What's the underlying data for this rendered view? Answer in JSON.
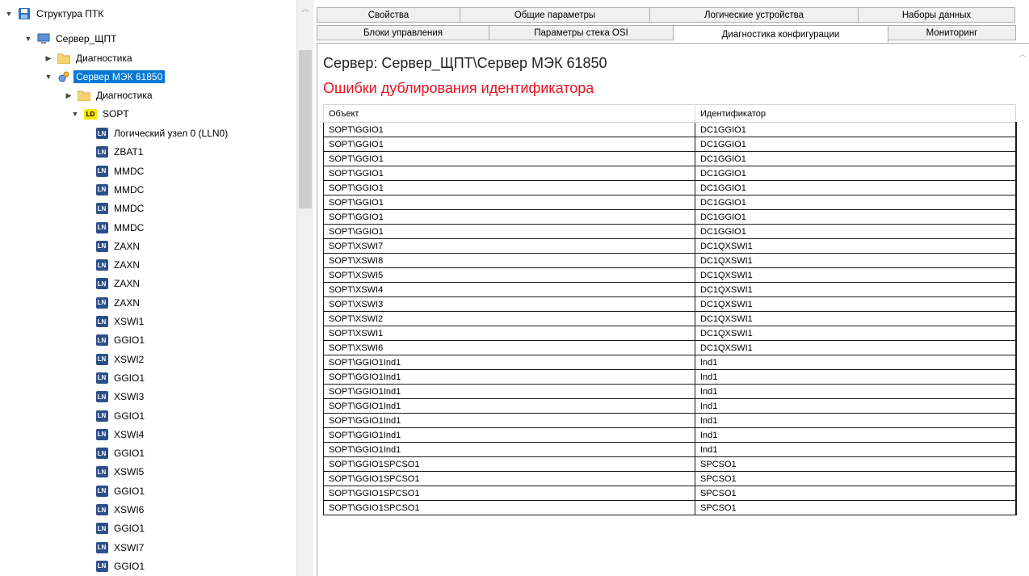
{
  "tree": {
    "root": "Структура ПТК",
    "server": "Сервер_ЩПТ",
    "diag1": "Диагностика",
    "mek_server": "Сервер МЭК 61850",
    "diag2": "Диагностика",
    "ld_badge": "LD",
    "ld_name": "SOPT",
    "ln_badge": "LN",
    "ln_items": [
      "Логический узел 0 (LLN0)",
      "ZBAT1",
      "MMDC",
      "MMDC",
      "MMDC",
      "MMDC",
      "ZAXN",
      "ZAXN",
      "ZAXN",
      "ZAXN",
      "XSWI1",
      "GGIO1",
      "XSWI2",
      "GGIO1",
      "XSWI3",
      "GGIO1",
      "XSWI4",
      "GGIO1",
      "XSWI5",
      "GGIO1",
      "XSWI6",
      "GGIO1",
      "XSWI7",
      "GGIO1"
    ]
  },
  "tabs": {
    "row1": [
      "Свойства",
      "Общие параметры",
      "Логические устройства",
      "Наборы данных"
    ],
    "row2": [
      "Блоки управления",
      "Параметры стека OSI",
      "Диагностика конфигурации",
      "Мониторинг"
    ],
    "active": "Диагностика конфигурации"
  },
  "content": {
    "server_title": "Сервер: Сервер_ЩПТ\\Сервер МЭК 61850",
    "error_title": "Ошибки дублирования идентификатора",
    "columns": [
      "Объект",
      "Идентификатор"
    ],
    "rows": [
      [
        "SOPT\\GGIO1",
        "DC1GGIO1"
      ],
      [
        "SOPT\\GGIO1",
        "DC1GGIO1"
      ],
      [
        "SOPT\\GGIO1",
        "DC1GGIO1"
      ],
      [
        "SOPT\\GGIO1",
        "DC1GGIO1"
      ],
      [
        "SOPT\\GGIO1",
        "DC1GGIO1"
      ],
      [
        "SOPT\\GGIO1",
        "DC1GGIO1"
      ],
      [
        "SOPT\\GGIO1",
        "DC1GGIO1"
      ],
      [
        "SOPT\\GGIO1",
        "DC1GGIO1"
      ],
      [
        "SOPT\\XSWI7",
        "DC1QXSWI1"
      ],
      [
        "SOPT\\XSWI8",
        "DC1QXSWI1"
      ],
      [
        "SOPT\\XSWI5",
        "DC1QXSWI1"
      ],
      [
        "SOPT\\XSWI4",
        "DC1QXSWI1"
      ],
      [
        "SOPT\\XSWI3",
        "DC1QXSWI1"
      ],
      [
        "SOPT\\XSWI2",
        "DC1QXSWI1"
      ],
      [
        "SOPT\\XSWI1",
        "DC1QXSWI1"
      ],
      [
        "SOPT\\XSWI6",
        "DC1QXSWI1"
      ],
      [
        "SOPT\\GGIO1Ind1",
        "Ind1"
      ],
      [
        "SOPT\\GGIO1Ind1",
        "Ind1"
      ],
      [
        "SOPT\\GGIO1Ind1",
        "Ind1"
      ],
      [
        "SOPT\\GGIO1Ind1",
        "Ind1"
      ],
      [
        "SOPT\\GGIO1Ind1",
        "Ind1"
      ],
      [
        "SOPT\\GGIO1Ind1",
        "Ind1"
      ],
      [
        "SOPT\\GGIO1Ind1",
        "Ind1"
      ],
      [
        "SOPT\\GGIO1SPCSO1",
        "SPCSO1"
      ],
      [
        "SOPT\\GGIO1SPCSO1",
        "SPCSO1"
      ],
      [
        "SOPT\\GGIO1SPCSO1",
        "SPCSO1"
      ],
      [
        "SOPT\\GGIO1SPCSO1",
        "SPCSO1"
      ]
    ]
  },
  "colors": {
    "selection": "#0078d7",
    "error_text": "#e81123",
    "ln_badge": "#2b4f8a",
    "ld_badge": "#f7e600"
  }
}
